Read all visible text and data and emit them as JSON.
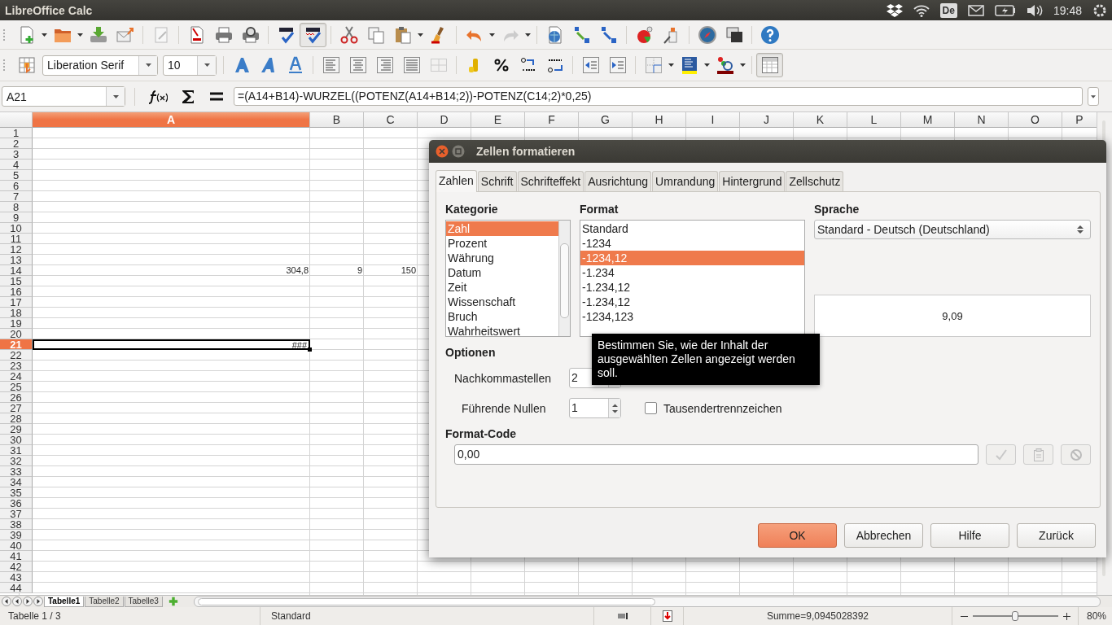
{
  "window": {
    "title": "LibreOffice Calc"
  },
  "system_tray": {
    "keyboard_layout": "De",
    "time": "19:48"
  },
  "toolbar": {
    "auto_spellcheck": {
      "on": true
    },
    "font_name": "Liberation Serif",
    "font_size": "10",
    "grid_lines": {
      "on": true
    }
  },
  "formula_bar": {
    "name_box": "A21",
    "formula": "=(A14+B14)-WURZEL((POTENZ(A14+B14;2))-POTENZ(C14;2)*0,25)"
  },
  "sheet": {
    "columns": [
      {
        "label": "A",
        "selected": true
      },
      {
        "label": "B",
        "selected": false
      },
      {
        "label": "C",
        "selected": false
      },
      {
        "label": "D",
        "selected": false
      },
      {
        "label": "E",
        "selected": false
      },
      {
        "label": "F",
        "selected": false
      },
      {
        "label": "G",
        "selected": false
      },
      {
        "label": "H",
        "selected": false
      },
      {
        "label": "I",
        "selected": false
      },
      {
        "label": "J",
        "selected": false
      },
      {
        "label": "K",
        "selected": false
      },
      {
        "label": "L",
        "selected": false
      },
      {
        "label": "M",
        "selected": false
      },
      {
        "label": "N",
        "selected": false
      },
      {
        "label": "O",
        "selected": false
      },
      {
        "label": "P",
        "selected": false
      }
    ],
    "rows": [
      {
        "label": "1",
        "selected": false
      },
      {
        "label": "2",
        "selected": false
      },
      {
        "label": "3",
        "selected": false
      },
      {
        "label": "4",
        "selected": false
      },
      {
        "label": "5",
        "selected": false
      },
      {
        "label": "6",
        "selected": false
      },
      {
        "label": "7",
        "selected": false
      },
      {
        "label": "8",
        "selected": false
      },
      {
        "label": "9",
        "selected": false
      },
      {
        "label": "10",
        "selected": false
      },
      {
        "label": "11",
        "selected": false
      },
      {
        "label": "12",
        "selected": false
      },
      {
        "label": "13",
        "selected": false
      },
      {
        "label": "14",
        "selected": false,
        "cells": [
          {
            "value": "304,8",
            "selected": false
          },
          {
            "value": "9",
            "selected": false
          },
          {
            "value": "150",
            "selected": false
          }
        ]
      },
      {
        "label": "15",
        "selected": false
      },
      {
        "label": "16",
        "selected": false
      },
      {
        "label": "17",
        "selected": false
      },
      {
        "label": "18",
        "selected": false
      },
      {
        "label": "19",
        "selected": false
      },
      {
        "label": "20",
        "selected": false
      },
      {
        "label": "21",
        "selected": true,
        "cells": [
          {
            "value": "###",
            "selected": true
          }
        ]
      },
      {
        "label": "22",
        "selected": false
      },
      {
        "label": "23",
        "selected": false
      },
      {
        "label": "24",
        "selected": false
      },
      {
        "label": "25",
        "selected": false
      },
      {
        "label": "26",
        "selected": false
      },
      {
        "label": "27",
        "selected": false
      },
      {
        "label": "28",
        "selected": false
      },
      {
        "label": "29",
        "selected": false
      },
      {
        "label": "30",
        "selected": false
      },
      {
        "label": "31",
        "selected": false
      },
      {
        "label": "32",
        "selected": false
      },
      {
        "label": "33",
        "selected": false
      },
      {
        "label": "34",
        "selected": false
      },
      {
        "label": "35",
        "selected": false
      },
      {
        "label": "36",
        "selected": false
      },
      {
        "label": "37",
        "selected": false
      },
      {
        "label": "38",
        "selected": false
      },
      {
        "label": "39",
        "selected": false
      },
      {
        "label": "40",
        "selected": false
      },
      {
        "label": "41",
        "selected": false
      },
      {
        "label": "42",
        "selected": false
      },
      {
        "label": "43",
        "selected": false
      },
      {
        "label": "44",
        "selected": false
      }
    ]
  },
  "sheet_tabs": [
    {
      "label": "Tabelle1",
      "selected": true
    },
    {
      "label": "Tabelle2",
      "selected": false
    },
    {
      "label": "Tabelle3",
      "selected": false
    }
  ],
  "status_bar": {
    "sheet": "Tabelle 1 / 3",
    "page_style": "Standard",
    "sum": "Summe=9,0945028392",
    "zoom": {
      "level": 0.5
    },
    "zoom_percent": "80%"
  },
  "dialog": {
    "title": "Zellen formatieren",
    "tabs": [
      {
        "label": "Zahlen",
        "selected": true
      },
      {
        "label": "Schrift",
        "selected": false
      },
      {
        "label": "Schrifteffekt",
        "selected": false
      },
      {
        "label": "Ausrichtung",
        "selected": false
      },
      {
        "label": "Umrandung",
        "selected": false
      },
      {
        "label": "Hintergrund",
        "selected": false
      },
      {
        "label": "Zellschutz",
        "selected": false
      }
    ],
    "category": {
      "label": "Kategorie",
      "items": [
        {
          "label": "Zahl",
          "selected": true
        },
        {
          "label": "Prozent",
          "selected": false
        },
        {
          "label": "Währung",
          "selected": false
        },
        {
          "label": "Datum",
          "selected": false
        },
        {
          "label": "Zeit",
          "selected": false
        },
        {
          "label": "Wissenschaft",
          "selected": false
        },
        {
          "label": "Bruch",
          "selected": false
        },
        {
          "label": "Wahrheitswert",
          "selected": false
        }
      ]
    },
    "format": {
      "label": "Format",
      "items": [
        {
          "label": "Standard",
          "selected": false
        },
        {
          "label": "-1234",
          "selected": false
        },
        {
          "label": "-1234,12",
          "selected": true
        },
        {
          "label": "-1.234",
          "selected": false
        },
        {
          "label": "-1.234,12",
          "selected": false
        },
        {
          "label": "-1.234,12",
          "selected": false
        },
        {
          "label": "-1234,123",
          "selected": false
        }
      ]
    },
    "language": {
      "label": "Sprache",
      "value": "Standard - Deutsch (Deutschland)"
    },
    "preview": "9,09",
    "options": {
      "label": "Optionen",
      "decimal_places": {
        "label": "Nachkommastellen",
        "value": "2"
      },
      "leading_zeros": {
        "label": "Führende Nullen",
        "value": "1"
      },
      "thousands_separator": {
        "label": "Tausendertrennzeichen",
        "checked": false
      }
    },
    "format_code": {
      "label": "Format-Code",
      "value": "0,00"
    },
    "buttons": [
      {
        "label": "OK",
        "kind": "default"
      },
      {
        "label": "Abbrechen",
        "kind": "normal"
      },
      {
        "label": "Hilfe",
        "kind": "normal"
      },
      {
        "label": "Zurück",
        "kind": "normal"
      }
    ],
    "tooltip": "Bestimmen Sie, wie der Inhalt der ausgewählten Zellen angezeigt werden soll."
  }
}
